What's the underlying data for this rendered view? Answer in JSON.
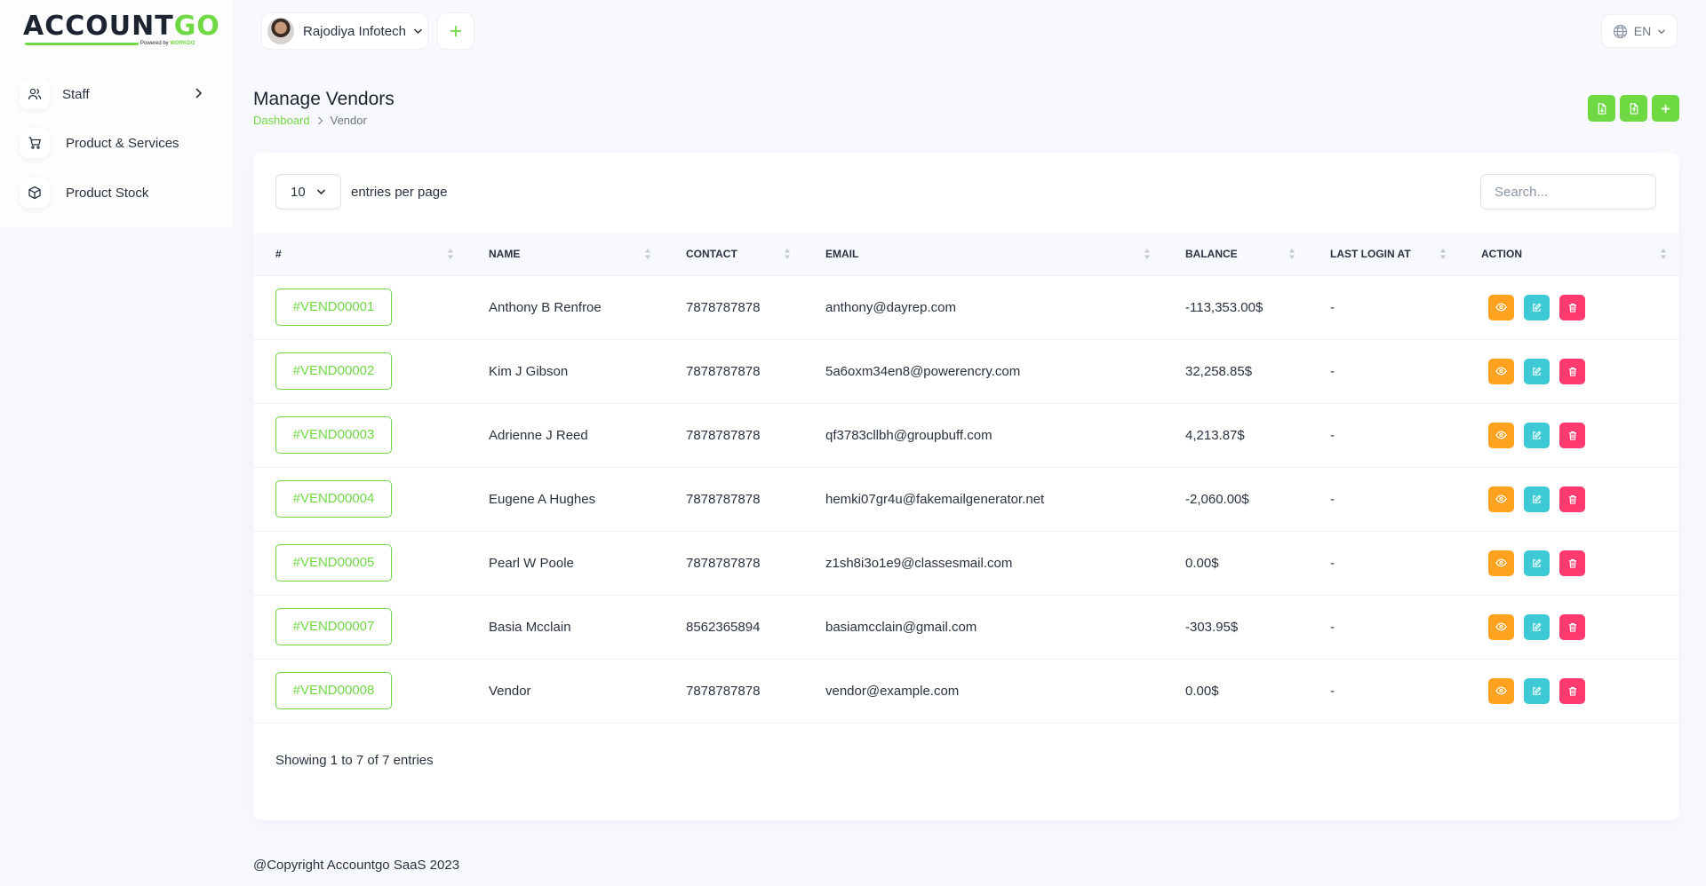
{
  "brand": {
    "logo_main": "ACCOUNT",
    "logo_accent": "GO",
    "logo_powered": "Powered by",
    "logo_powered_brand": "WORKDO"
  },
  "sidebar": {
    "items": [
      {
        "label": "Staff"
      },
      {
        "label": "Product & Services"
      },
      {
        "label": "Product Stock"
      }
    ]
  },
  "topbar": {
    "company_name": "Rajodiya Infotech",
    "language": "EN"
  },
  "page": {
    "title": "Manage Vendors",
    "breadcrumb": {
      "home": "Dashboard",
      "current": "Vendor"
    }
  },
  "table_controls": {
    "entries_value": "10",
    "entries_label": "entries per page",
    "search_placeholder": "Search..."
  },
  "table": {
    "columns": [
      "#",
      "NAME",
      "CONTACT",
      "EMAIL",
      "BALANCE",
      "LAST LOGIN AT",
      "ACTION"
    ],
    "rows": [
      {
        "id": "#VEND00001",
        "name": "Anthony B Renfroe",
        "contact": "7878787878",
        "email": "anthony@dayrep.com",
        "balance": "-113,353.00$",
        "last_login": "-"
      },
      {
        "id": "#VEND00002",
        "name": "Kim J Gibson",
        "contact": "7878787878",
        "email": "5a6oxm34en8@powerencry.com",
        "balance": "32,258.85$",
        "last_login": "-"
      },
      {
        "id": "#VEND00003",
        "name": "Adrienne J Reed",
        "contact": "7878787878",
        "email": "qf3783cllbh@groupbuff.com",
        "balance": "4,213.87$",
        "last_login": "-"
      },
      {
        "id": "#VEND00004",
        "name": "Eugene A Hughes",
        "contact": "7878787878",
        "email": "hemki07gr4u@fakemailgenerator.net",
        "balance": "-2,060.00$",
        "last_login": "-"
      },
      {
        "id": "#VEND00005",
        "name": "Pearl W Poole",
        "contact": "7878787878",
        "email": "z1sh8i3o1e9@classesmail.com",
        "balance": "0.00$",
        "last_login": "-"
      },
      {
        "id": "#VEND00007",
        "name": "Basia Mcclain",
        "contact": "8562365894",
        "email": "basiamcclain@gmail.com",
        "balance": "-303.95$",
        "last_login": "-"
      },
      {
        "id": "#VEND00008",
        "name": "Vendor",
        "contact": "7878787878",
        "email": "vendor@example.com",
        "balance": "0.00$",
        "last_login": "-"
      }
    ]
  },
  "showing": "Showing 1 to 7 of 7 entries",
  "footer": "@Copyright Accountgo SaaS 2023",
  "colors": {
    "primary": "#6fd943",
    "view": "#ffa21d",
    "edit": "#3ec9d6",
    "delete": "#ff3a6e"
  }
}
